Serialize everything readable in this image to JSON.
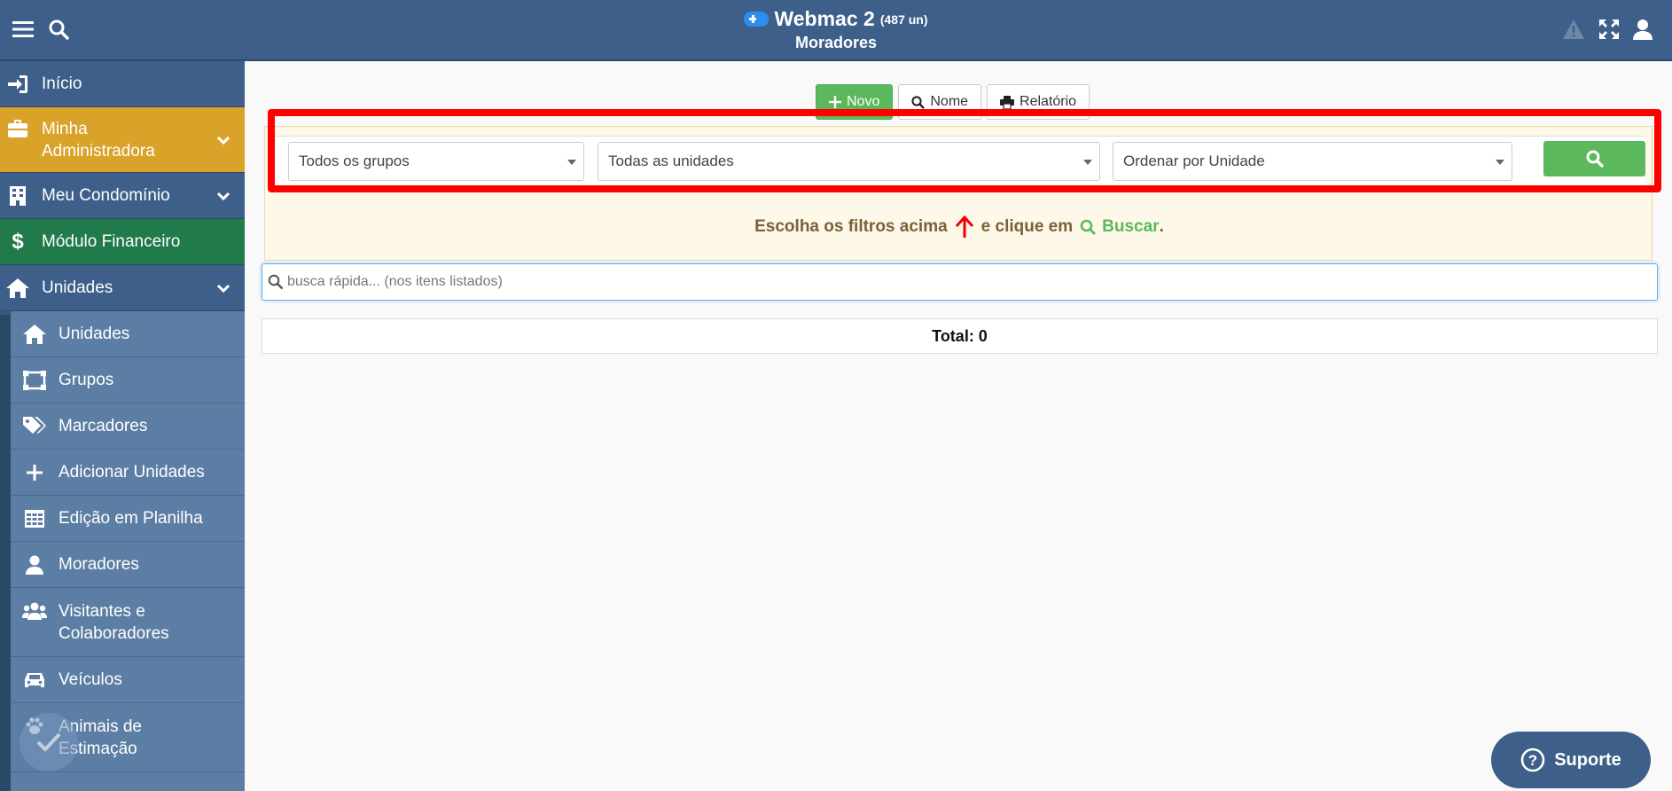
{
  "header": {
    "app_name": "Webmac 2",
    "unit_count": "(487 un)",
    "page_title": "Moradores"
  },
  "sidebar": {
    "items": [
      {
        "label": "Início",
        "icon": "sign-in-icon"
      },
      {
        "label": "Minha Administradora",
        "icon": "briefcase-icon",
        "color": "#d9a329"
      },
      {
        "label": "Meu Condomínio",
        "icon": "building-icon"
      },
      {
        "label": "Módulo Financeiro",
        "icon": "dollar-icon",
        "color": "#207a4a"
      },
      {
        "label": "Unidades",
        "icon": "home-icon"
      }
    ],
    "subitems": [
      {
        "label": "Unidades",
        "icon": "home-icon"
      },
      {
        "label": "Grupos",
        "icon": "object-group-icon"
      },
      {
        "label": "Marcadores",
        "icon": "tags-icon"
      },
      {
        "label": "Adicionar Unidades",
        "icon": "plus-icon"
      },
      {
        "label": "Edição em Planilha",
        "icon": "table-icon"
      },
      {
        "label": "Moradores",
        "icon": "user-icon"
      },
      {
        "label": "Visitantes e Colaboradores",
        "icon": "users-icon"
      },
      {
        "label": "Veículos",
        "icon": "car-icon"
      },
      {
        "label": "Animais de Estimação",
        "icon": "paw-icon"
      }
    ]
  },
  "toolbar": {
    "novo_label": "Novo",
    "nome_label": "Nome",
    "relatorio_label": "Relatório"
  },
  "filters": {
    "grupos": "Todos os grupos",
    "unidades": "Todas as unidades",
    "ordenar": "Ordenar por Unidade"
  },
  "hint": {
    "part1": "Escolha os filtros acima",
    "part2": "e clique em",
    "buscar": "Buscar",
    "dot": "."
  },
  "quick_search": {
    "placeholder": "busca rápida... (nos itens listados)"
  },
  "total": {
    "label": "Total: 0"
  },
  "support": {
    "label": "Suporte"
  },
  "colors": {
    "header": "#3d5f8a",
    "green": "#5cb85c",
    "highlight": "#ff0000"
  }
}
